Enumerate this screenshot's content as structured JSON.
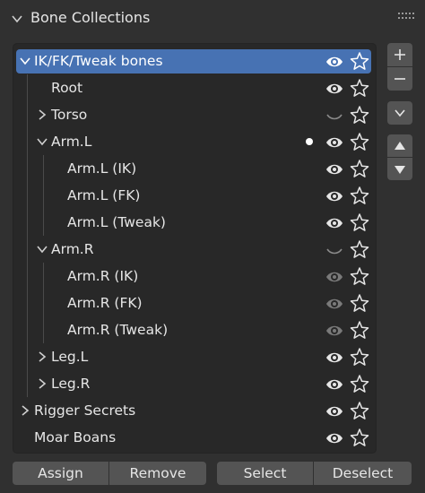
{
  "panel": {
    "title": "Bone Collections"
  },
  "rows": [
    {
      "label": "IK/FK/Tweak bones",
      "eye": "visible",
      "expanded": true
    },
    {
      "label": "Root",
      "eye": "visible"
    },
    {
      "label": "Torso",
      "eye": "hidden",
      "expanded": false
    },
    {
      "label": "Arm.L",
      "eye": "visible",
      "expanded": true,
      "active_dot": true
    },
    {
      "label": "Arm.L (IK)",
      "eye": "visible"
    },
    {
      "label": "Arm.L (FK)",
      "eye": "visible"
    },
    {
      "label": "Arm.L (Tweak)",
      "eye": "visible"
    },
    {
      "label": "Arm.R",
      "eye": "hidden",
      "expanded": true
    },
    {
      "label": "Arm.R (IK)",
      "eye": "dimmed"
    },
    {
      "label": "Arm.R (FK)",
      "eye": "dimmed"
    },
    {
      "label": "Arm.R (Tweak)",
      "eye": "dimmed"
    },
    {
      "label": "Leg.L",
      "eye": "visible",
      "expanded": false
    },
    {
      "label": "Leg.R",
      "eye": "visible",
      "expanded": false
    },
    {
      "label": "Rigger Secrets",
      "eye": "visible",
      "expanded": false
    },
    {
      "label": "Moar Boans",
      "eye": "visible"
    }
  ],
  "buttons": {
    "assign": "Assign",
    "remove": "Remove",
    "select": "Select",
    "deselect": "Deselect"
  },
  "colors": {
    "selected_row": "#4772b3",
    "panel_bg": "#303030",
    "list_bg": "#282828",
    "button_bg": "#545454"
  }
}
